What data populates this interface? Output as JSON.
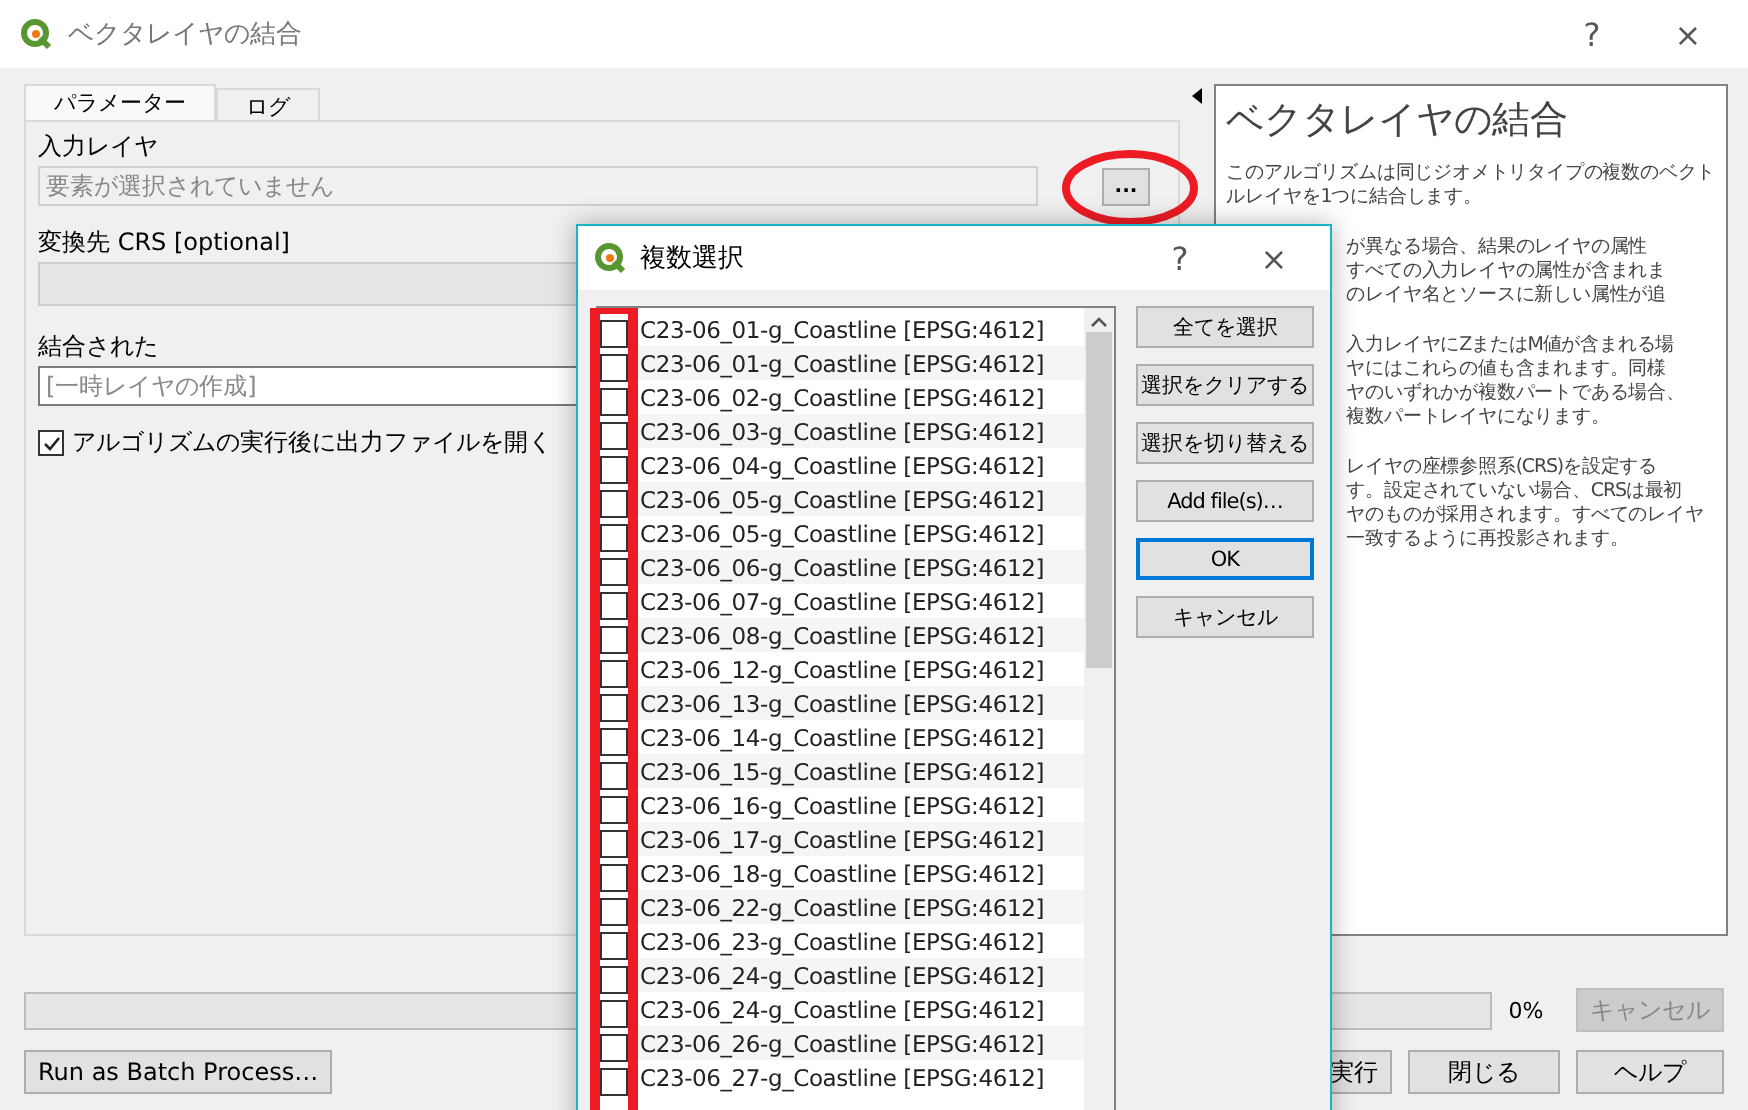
{
  "window": {
    "title": "ベクタレイヤの結合",
    "help": "?",
    "close": "×"
  },
  "tabs": [
    {
      "label": "パラメーター",
      "selected": true
    },
    {
      "label": "ログ",
      "selected": false
    }
  ],
  "params": {
    "input_label": "入力レイヤ",
    "input_placeholder": "要素が選択されていません",
    "browse": "...",
    "crs_label": "変換先 CRS [optional]",
    "output_label": "結合された",
    "output_placeholder": "[一時レイヤの作成]",
    "open_after": {
      "label": "アルゴリズムの実行後に出力ファイルを開く",
      "checked": true
    }
  },
  "help": {
    "title": "ベクタレイヤの結合",
    "paragraphs": [
      {
        "kind": "full",
        "lines": [
          "このアルゴリズムは同じジオメトリタイプの複数のベクト",
          "ルレイヤを1つに結合します。"
        ]
      },
      {
        "kind": "partial",
        "lines": [
          "が異なる場合、結果のレイヤの属性",
          "すべての入力レイヤの属性が含まれま",
          "のレイヤ名とソースに新しい属性が追"
        ]
      },
      {
        "kind": "partial",
        "lines": [
          "入力レイヤにZまたはM値が含まれる場",
          "ヤにはこれらの値も含まれます。同様",
          "ヤのいずれかが複数パートである場合、",
          "複数パートレイヤになります。"
        ]
      },
      {
        "kind": "partial",
        "lines": [
          "レイヤの座標参照系(CRS)を設定する",
          "す。設定されていない場合、CRSは最初",
          "ヤのものが採用されます。すべてのレイヤ",
          "一致するように再投影されます。"
        ]
      }
    ]
  },
  "footer": {
    "progress": {
      "level": 0,
      "reading": "0%"
    },
    "cancel": {
      "label": "キャンセル",
      "disabled": true
    },
    "batch": "Run as Batch Process…",
    "run": "実行",
    "close": "閉じる",
    "help": "ヘルプ"
  },
  "dialog": {
    "title": "複数選択",
    "help": "?",
    "close": "×",
    "items": [
      {
        "label": "C23-06_01-g_Coastline [EPSG:4612]",
        "checked": false
      },
      {
        "label": "C23-06_01-g_Coastline [EPSG:4612]",
        "checked": false
      },
      {
        "label": "C23-06_02-g_Coastline [EPSG:4612]",
        "checked": false
      },
      {
        "label": "C23-06_03-g_Coastline [EPSG:4612]",
        "checked": false
      },
      {
        "label": "C23-06_04-g_Coastline [EPSG:4612]",
        "checked": false
      },
      {
        "label": "C23-06_05-g_Coastline [EPSG:4612]",
        "checked": false
      },
      {
        "label": "C23-06_05-g_Coastline [EPSG:4612]",
        "checked": false
      },
      {
        "label": "C23-06_06-g_Coastline [EPSG:4612]",
        "checked": false
      },
      {
        "label": "C23-06_07-g_Coastline [EPSG:4612]",
        "checked": false
      },
      {
        "label": "C23-06_08-g_Coastline [EPSG:4612]",
        "checked": false
      },
      {
        "label": "C23-06_12-g_Coastline [EPSG:4612]",
        "checked": false
      },
      {
        "label": "C23-06_13-g_Coastline [EPSG:4612]",
        "checked": false
      },
      {
        "label": "C23-06_14-g_Coastline [EPSG:4612]",
        "checked": false
      },
      {
        "label": "C23-06_15-g_Coastline [EPSG:4612]",
        "checked": false
      },
      {
        "label": "C23-06_16-g_Coastline [EPSG:4612]",
        "checked": false
      },
      {
        "label": "C23-06_17-g_Coastline [EPSG:4612]",
        "checked": false
      },
      {
        "label": "C23-06_18-g_Coastline [EPSG:4612]",
        "checked": false
      },
      {
        "label": "C23-06_22-g_Coastline [EPSG:4612]",
        "checked": false
      },
      {
        "label": "C23-06_23-g_Coastline [EPSG:4612]",
        "checked": false
      },
      {
        "label": "C23-06_24-g_Coastline [EPSG:4612]",
        "checked": false
      },
      {
        "label": "C23-06_24-g_Coastline [EPSG:4612]",
        "checked": false
      },
      {
        "label": "C23-06_26-g_Coastline [EPSG:4612]",
        "checked": false
      },
      {
        "label": "C23-06_27-g_Coastline [EPSG:4612]",
        "checked": false
      }
    ],
    "buttons": [
      {
        "label": "全てを選択",
        "focused": false
      },
      {
        "label": "選択をクリアする",
        "focused": false
      },
      {
        "label": "選択を切り替える",
        "focused": false
      },
      {
        "label": "Add file(s)…",
        "focused": false
      },
      {
        "label": "OK",
        "focused": true
      },
      {
        "label": "キャンセル",
        "focused": false
      }
    ]
  }
}
